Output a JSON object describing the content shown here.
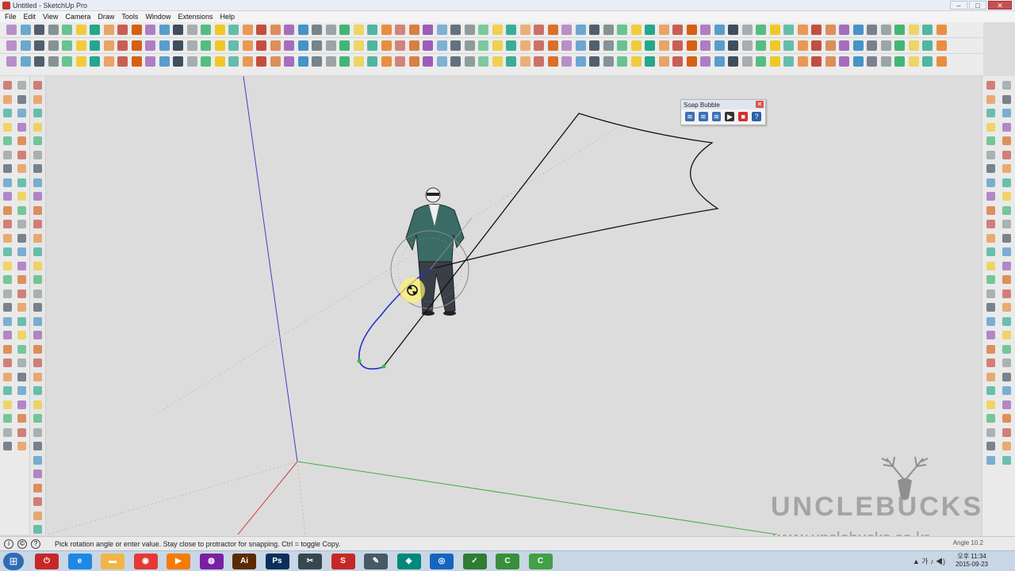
{
  "window": {
    "title": "Untitled - SketchUp Pro",
    "buttons": [
      "–",
      "□",
      "✕"
    ]
  },
  "menu": [
    "File",
    "Edit",
    "View",
    "Camera",
    "Draw",
    "Tools",
    "Window",
    "Extensions",
    "Help"
  ],
  "soap_bubble": {
    "title": "Soap Bubble",
    "close": "✕",
    "buttons": [
      {
        "icon": "soap-bubble-tool-1-icon",
        "glyph": "≋",
        "color": "#3b6fb6"
      },
      {
        "icon": "soap-bubble-tool-2-icon",
        "glyph": "≋",
        "color": "#3b6fb6"
      },
      {
        "icon": "soap-bubble-tool-3-icon",
        "glyph": "≋",
        "color": "#3b6fb6"
      },
      {
        "icon": "play-icon",
        "glyph": "▶",
        "color": "#333333"
      },
      {
        "icon": "stop-icon",
        "glyph": "■",
        "color": "#d32f2f"
      },
      {
        "icon": "help-icon",
        "glyph": "?",
        "color": "#2962a8"
      }
    ]
  },
  "status": {
    "message": "Pick rotation angle or enter value.  Stay close to protractor for snapping. Ctrl = toggle Copy.",
    "vcb_label": "Angle",
    "vcb_value": "10.2"
  },
  "watermark": {
    "brand": "UNCLEBUCKS",
    "url": "www.unclebucks.co.kr"
  },
  "taskbar": {
    "apps": [
      {
        "name": "power-icon",
        "glyph": "⏻",
        "color": "#c62828"
      },
      {
        "name": "ie-icon",
        "glyph": "e",
        "color": "#1e88e5"
      },
      {
        "name": "folder-icon",
        "glyph": "▬",
        "color": "#f0b64a"
      },
      {
        "name": "chrome-icon",
        "glyph": "◉",
        "color": "#e53935"
      },
      {
        "name": "media-icon",
        "glyph": "▶",
        "color": "#f57c00"
      },
      {
        "name": "purple-app-icon",
        "glyph": "◍",
        "color": "#7b1fa2"
      },
      {
        "name": "illustrator-icon",
        "glyph": "Ai",
        "color": "#5b2a00"
      },
      {
        "name": "photoshop-icon",
        "glyph": "Ps",
        "color": "#0d2e5b"
      },
      {
        "name": "tool-app-icon",
        "glyph": "✂",
        "color": "#37474f"
      },
      {
        "name": "sketchup-icon",
        "glyph": "S",
        "color": "#c62828"
      },
      {
        "name": "layout-icon",
        "glyph": "✎",
        "color": "#455a64"
      },
      {
        "name": "style-builder-icon",
        "glyph": "◆",
        "color": "#00897b"
      },
      {
        "name": "settings-app-icon",
        "glyph": "◎",
        "color": "#1565c0"
      },
      {
        "name": "pen-app-icon",
        "glyph": "✓",
        "color": "#2e7d32"
      },
      {
        "name": "camtasia-icon",
        "glyph": "C",
        "color": "#388e3c"
      },
      {
        "name": "camtasia2-icon",
        "glyph": "C",
        "color": "#43a047"
      }
    ],
    "tray": "▲ 가 ♪ ◀)",
    "time": "오후 11:34",
    "date": "2015-09-23"
  },
  "colors": {
    "red_axis": "#d04040",
    "green_axis": "#40b040",
    "blue_axis": "#4040c0",
    "arc": "#2030d0",
    "line": "#111111"
  }
}
